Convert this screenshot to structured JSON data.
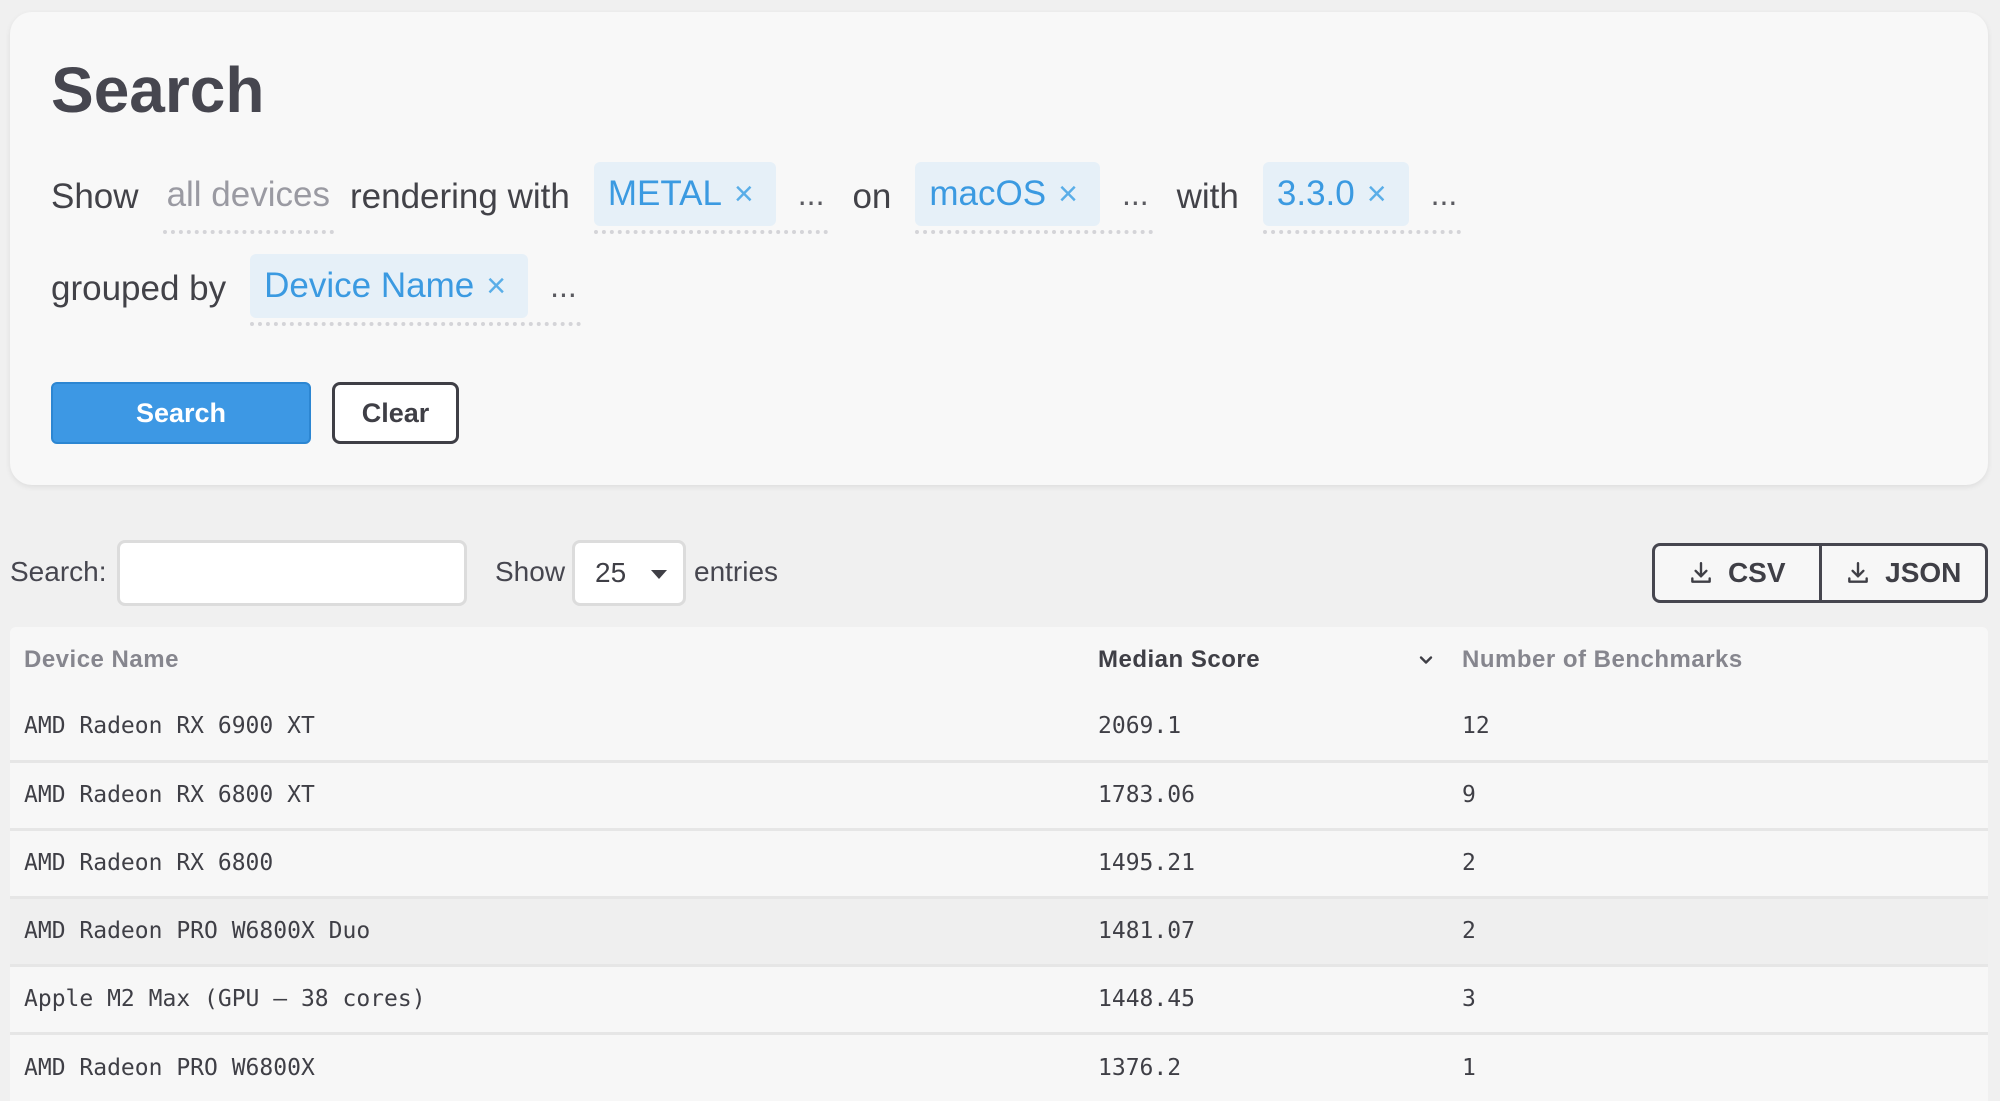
{
  "search_card": {
    "title": "Search",
    "row1": {
      "show_label": "Show",
      "devices_placeholder": "all devices",
      "rendering_label": "rendering with",
      "api_tag": "METAL",
      "on_label": "on",
      "os_tag": "macOS",
      "with_label": "with",
      "version_tag": "3.3.0",
      "more": "..."
    },
    "row2": {
      "grouped_label": "grouped by",
      "group_tag": "Device Name",
      "more": "..."
    },
    "remove_icon": "×",
    "search_button": "Search",
    "clear_button": "Clear"
  },
  "toolbar": {
    "search_label": "Search:",
    "search_value": "",
    "show_label": "Show",
    "page_size": "25",
    "entries_label": "entries",
    "export_csv": "CSV",
    "export_json": "JSON"
  },
  "table": {
    "columns": [
      "Device Name",
      "Median Score",
      "Number of Benchmarks"
    ],
    "sorted_column": "Median Score",
    "rows": [
      {
        "device": "AMD Radeon RX 6900 XT",
        "score": "2069.1",
        "benchmarks": "12"
      },
      {
        "device": "AMD Radeon RX 6800 XT",
        "score": "1783.06",
        "benchmarks": "9"
      },
      {
        "device": "AMD Radeon RX 6800",
        "score": "1495.21",
        "benchmarks": "2"
      },
      {
        "device": "AMD Radeon PRO W6800X Duo",
        "score": "1481.07",
        "benchmarks": "2"
      },
      {
        "device": "Apple M2 Max (GPU – 38 cores)",
        "score": "1448.45",
        "benchmarks": "3"
      },
      {
        "device": "AMD Radeon PRO W6800X",
        "score": "1376.2",
        "benchmarks": "1"
      }
    ]
  },
  "icons": {
    "remove": "close-icon",
    "dropdown": "caret-down-icon",
    "download": "download-icon",
    "sort": "chevron-down-icon"
  },
  "colors": {
    "accent": "#3d98e4",
    "tag_background": "#e6f0f8",
    "tag_text": "#3b9ae1"
  }
}
